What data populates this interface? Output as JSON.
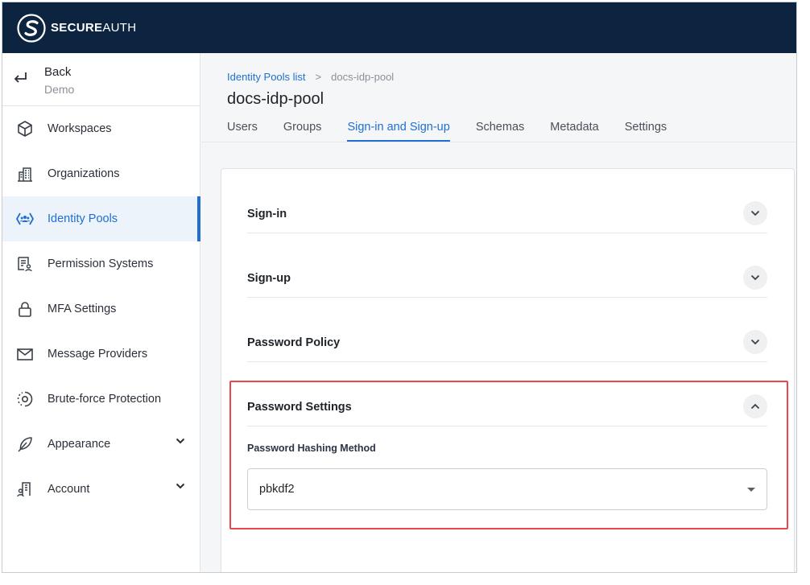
{
  "brand": {
    "bold": "SECURE",
    "light": "AUTH",
    "colors": {
      "header_bg": "#0d2440",
      "accent": "#1f6fd1",
      "highlight": "#e8474c"
    }
  },
  "sidebar": {
    "back": {
      "label": "Back",
      "sub": "Demo",
      "icon": "return-arrow-icon"
    },
    "items": [
      {
        "label": "Workspaces",
        "icon": "cube-icon"
      },
      {
        "label": "Organizations",
        "icon": "buildings-icon"
      },
      {
        "label": "Identity Pools",
        "icon": "identity-pool-icon",
        "active": true
      },
      {
        "label": "Permission Systems",
        "icon": "permission-doc-icon"
      },
      {
        "label": "MFA Settings",
        "icon": "lock-icon"
      },
      {
        "label": "Message Providers",
        "icon": "envelope-icon"
      },
      {
        "label": "Brute-force Protection",
        "icon": "shield-target-icon"
      },
      {
        "label": "Appearance",
        "icon": "feather-icon",
        "expandable": true
      },
      {
        "label": "Account",
        "icon": "account-building-icon",
        "expandable": true
      }
    ]
  },
  "breadcrumb": {
    "parent": "Identity Pools list",
    "separator": ">",
    "current": "docs-idp-pool"
  },
  "page": {
    "title": "docs-idp-pool"
  },
  "tabs": [
    "Users",
    "Groups",
    "Sign-in and Sign-up",
    "Schemas",
    "Metadata",
    "Settings"
  ],
  "active_tab": "Sign-in and Sign-up",
  "sections": [
    {
      "title": "Sign-in",
      "expanded": false
    },
    {
      "title": "Sign-up",
      "expanded": false
    },
    {
      "title": "Password Policy",
      "expanded": false
    },
    {
      "title": "Password Settings",
      "expanded": true
    }
  ],
  "password_settings": {
    "field_label": "Password Hashing Method",
    "value": "pbkdf2"
  }
}
